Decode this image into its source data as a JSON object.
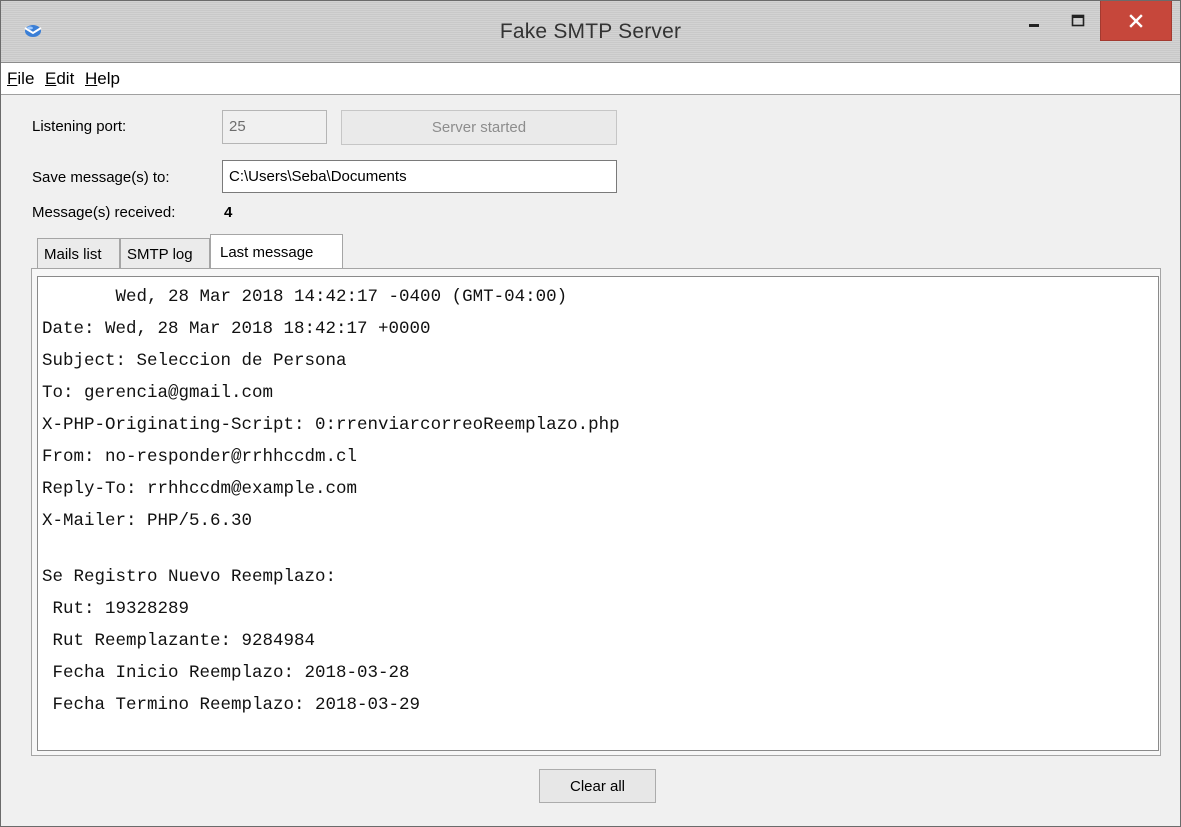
{
  "window": {
    "title": "Fake SMTP Server"
  },
  "menu": [
    {
      "underline": "F",
      "rest": "ile"
    },
    {
      "underline": "E",
      "rest": "dit"
    },
    {
      "underline": "H",
      "rest": "elp"
    }
  ],
  "form": {
    "port_label": "Listening port:",
    "port_value": "25",
    "server_button": "Server started",
    "save_label": "Save message(s) to:",
    "save_value": "C:\\Users\\Seba\\Documents",
    "received_label": "Message(s) received:",
    "received_count": "4"
  },
  "tabs": [
    {
      "label": "Mails list",
      "active": false
    },
    {
      "label": "SMTP log",
      "active": false
    },
    {
      "label": "Last message",
      "active": true
    }
  ],
  "message_lines": [
    "       Wed, 28 Mar 2018 14:42:17 -0400 (GMT-04:00)",
    "Date: Wed, 28 Mar 2018 18:42:17 +0000",
    "Subject: Seleccion de Persona",
    "To: gerencia@gmail.com",
    "X-PHP-Originating-Script: 0:rrenviarcorreoReemplazo.php",
    "From: no-responder@rrhhccdm.cl",
    "Reply-To: rrhhccdm@example.com",
    "X-Mailer: PHP/5.6.30",
    "",
    "Se Registro Nuevo Reemplazo:",
    " Rut: 19328289",
    " Rut Reemplazante: 9284984",
    " Fecha Inicio Reemplazo: 2018-03-28",
    " Fecha Termino Reemplazo: 2018-03-29"
  ],
  "footer": {
    "clear_button": "Clear all"
  },
  "colors": {
    "close_button": "#c6473b",
    "titlebar": "#cfcfcf"
  }
}
